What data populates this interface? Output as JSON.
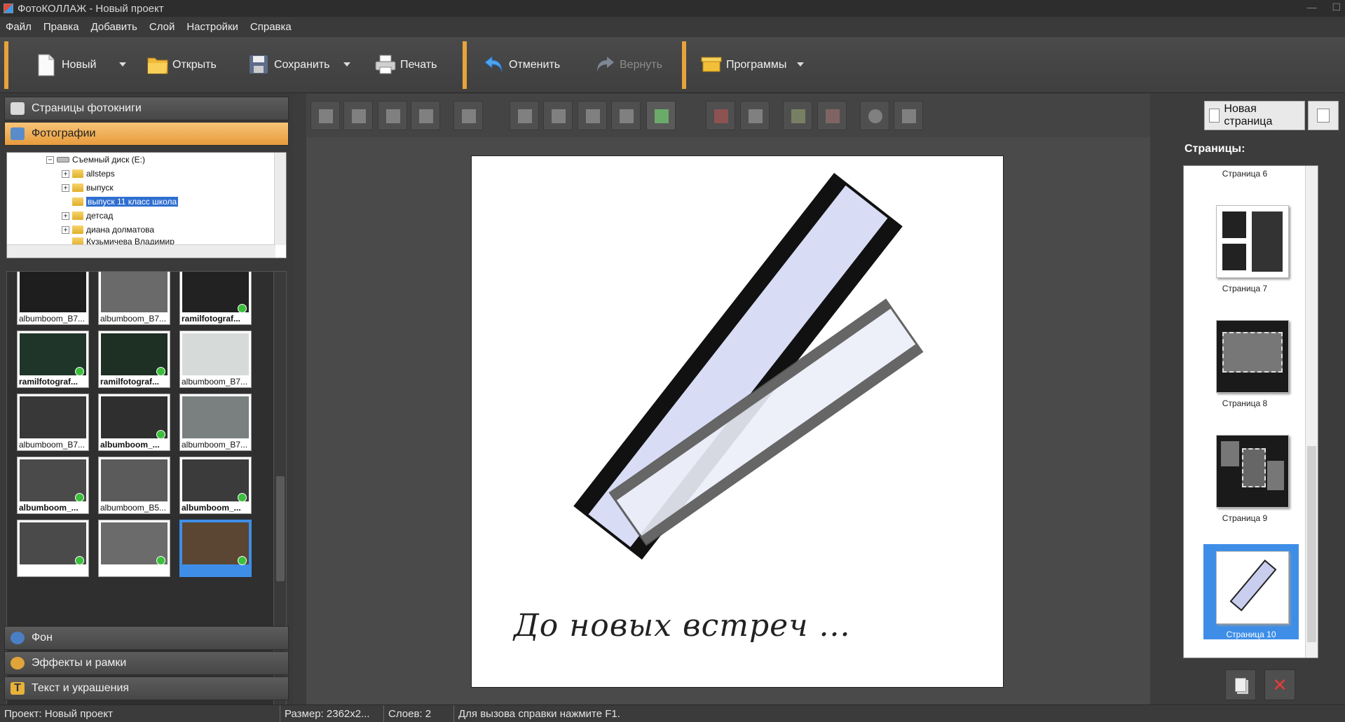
{
  "window": {
    "title": "ФотоКОЛЛАЖ - Новый проект"
  },
  "menu": [
    "Файл",
    "Правка",
    "Добавить",
    "Слой",
    "Настройки",
    "Справка"
  ],
  "toolbar": {
    "new": "Новый",
    "open": "Открыть",
    "save": "Сохранить",
    "print": "Печать",
    "undo": "Отменить",
    "redo": "Вернуть",
    "programs": "Программы"
  },
  "left_panel": {
    "sections": {
      "pages": "Страницы фотокниги",
      "photos": "Фотографии",
      "background": "Фон",
      "effects": "Эффекты и рамки",
      "text": "Текст и украшения"
    },
    "tree": {
      "drive": "Съемный диск (E:)",
      "folders": [
        "allsteps",
        "выпуск",
        "выпуск 11 класс школа",
        "детсад",
        "диана долматова",
        "Кузьмичева Владимир"
      ],
      "selected_index": 2
    },
    "thumbnails": [
      {
        "label": "albumboom_B7...",
        "bold": false,
        "check": false
      },
      {
        "label": "albumboom_B7...",
        "bold": false,
        "check": false
      },
      {
        "label": "ramilfotograf...",
        "bold": true,
        "check": true
      },
      {
        "label": "ramilfotograf...",
        "bold": true,
        "check": true
      },
      {
        "label": "ramilfotograf...",
        "bold": true,
        "check": true
      },
      {
        "label": "albumboom_B7...",
        "bold": false,
        "check": false
      },
      {
        "label": "albumboom_B7...",
        "bold": false,
        "check": false
      },
      {
        "label": "albumboom_...",
        "bold": true,
        "check": true
      },
      {
        "label": "albumboom_B7...",
        "bold": false,
        "check": false
      },
      {
        "label": "albumboom_...",
        "bold": true,
        "check": true
      },
      {
        "label": "albumboom_B5...",
        "bold": false,
        "check": false
      },
      {
        "label": "albumboom_...",
        "bold": true,
        "check": true
      },
      {
        "label": "",
        "bold": false,
        "check": true
      },
      {
        "label": "",
        "bold": false,
        "check": true
      },
      {
        "label": "",
        "bold": false,
        "check": true,
        "selected": true
      }
    ]
  },
  "canvas": {
    "caption": "До новых встреч ..."
  },
  "right_panel": {
    "new_page": "Новая страница",
    "pages_label": "Страницы:",
    "pages": [
      "Страница 6",
      "Страница 7",
      "Страница 8",
      "Страница 9",
      "Страница 10"
    ],
    "selected_page": "Страница 10"
  },
  "status": {
    "project": "Проект:  Новый проект",
    "size": "Размер:  2362x2...",
    "layers": "Слоев:  2",
    "help": "Для вызова справки нажмите F1."
  },
  "colors": {
    "accent": "#e8a33c",
    "selection": "#3e8ee8",
    "check": "#3cbf3c"
  }
}
